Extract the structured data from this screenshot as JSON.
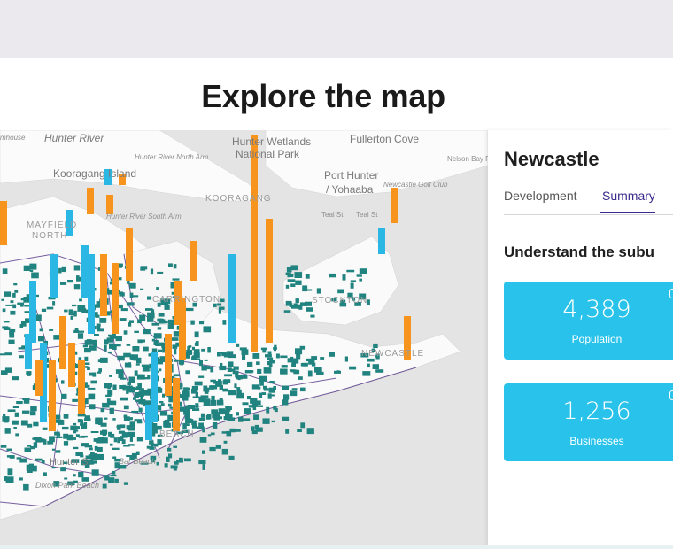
{
  "page": {
    "heading": "Explore the map"
  },
  "map": {
    "labels": {
      "hunter_river": "Hunter River",
      "hunter_wetlands": "Hunter Wetlands",
      "national_park": "National Park",
      "fullerton_cove": "Fullerton Cove",
      "kooragang_island": "Kooragang Island",
      "hunter_river_north_arm": "Hunter River North Arm",
      "port_hunter": "Port Hunter",
      "yohaaba": "/ Yohaaba",
      "nelson_bay_rd": "Nelson Bay Rd",
      "newcastle_golf_club": "Newcastle Golf Club",
      "kooragang": "KOORAGANG",
      "hunter_river_south_arm": "Hunter River South Arm",
      "teal_st_1": "Teal St",
      "teal_st_2": "Teal St",
      "mayfield": "MAYFIELD",
      "north": "NORTH",
      "carrington": "CARRINGTON",
      "stockton": "STOCKTON",
      "newcastle": "NEWCASTLE",
      "hunter_st": "Hunter St",
      "bar_beach": "Bar Beach",
      "beach": "BEACH",
      "dixon_park_beach": "Dixon Park Beach",
      "mayfield_west": "mhouse"
    },
    "colors": {
      "water": "#e5e4e4",
      "land": "#fafafa",
      "building": "#21837f",
      "bar_orange": "#f7941d",
      "bar_blue": "#2bb7e3",
      "boundary": "#4b2a80"
    }
  },
  "panel": {
    "suburb": "Newcastle",
    "tabs": [
      {
        "label": "Development",
        "active": false
      },
      {
        "label": "Summary",
        "active": true
      }
    ],
    "subheading": "Understand the subu",
    "stats": [
      {
        "value": "4,389",
        "label": "Population"
      },
      {
        "value": "1,256",
        "label": "Businesses"
      }
    ]
  }
}
